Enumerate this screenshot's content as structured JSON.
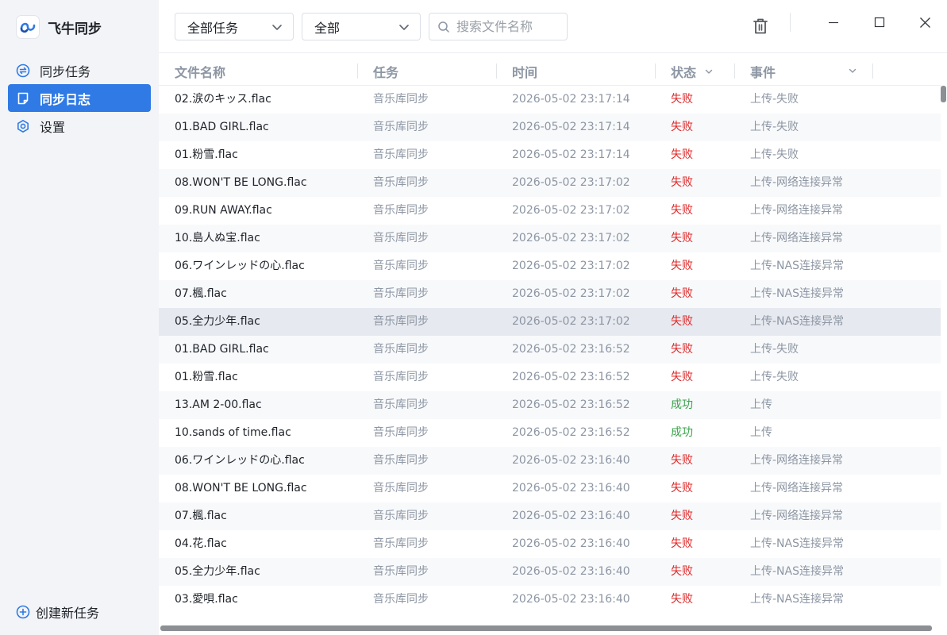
{
  "app": {
    "name": "飞牛同步"
  },
  "sidebar": {
    "items": [
      {
        "label": "同步任务",
        "icon": "sync-icon",
        "active": false
      },
      {
        "label": "同步日志",
        "icon": "log-icon",
        "active": true
      },
      {
        "label": "设置",
        "icon": "gear-icon",
        "active": false
      }
    ],
    "create_label": "创建新任务"
  },
  "toolbar": {
    "task_filter": "全部任务",
    "type_filter": "全部",
    "search_placeholder": "搜索文件名称"
  },
  "table": {
    "columns": [
      "文件名称",
      "任务",
      "时间",
      "状态",
      "事件"
    ],
    "selected_row": 8,
    "status_colors": {
      "失败": "#e02828",
      "成功": "#38a34a"
    },
    "rows": [
      {
        "name": "02.涙のキッス.flac",
        "task": "音乐库同步",
        "time": "2026-05-02 23:17:14",
        "status": "失败",
        "event": "上传-失败"
      },
      {
        "name": "01.BAD GIRL.flac",
        "task": "音乐库同步",
        "time": "2026-05-02 23:17:14",
        "status": "失败",
        "event": "上传-失败"
      },
      {
        "name": "01.粉雪.flac",
        "task": "音乐库同步",
        "time": "2026-05-02 23:17:14",
        "status": "失败",
        "event": "上传-失败"
      },
      {
        "name": "08.WON'T BE LONG.flac",
        "task": "音乐库同步",
        "time": "2026-05-02 23:17:02",
        "status": "失败",
        "event": "上传-网络连接异常"
      },
      {
        "name": "09.RUN AWAY.flac",
        "task": "音乐库同步",
        "time": "2026-05-02 23:17:02",
        "status": "失败",
        "event": "上传-网络连接异常"
      },
      {
        "name": "10.島人ぬ宝.flac",
        "task": "音乐库同步",
        "time": "2026-05-02 23:17:02",
        "status": "失败",
        "event": "上传-网络连接异常"
      },
      {
        "name": "06.ワインレッドの心.flac",
        "task": "音乐库同步",
        "time": "2026-05-02 23:17:02",
        "status": "失败",
        "event": "上传-NAS连接异常"
      },
      {
        "name": "07.楓.flac",
        "task": "音乐库同步",
        "time": "2026-05-02 23:17:02",
        "status": "失败",
        "event": "上传-NAS连接异常"
      },
      {
        "name": "05.全力少年.flac",
        "task": "音乐库同步",
        "time": "2026-05-02 23:17:02",
        "status": "失败",
        "event": "上传-NAS连接异常"
      },
      {
        "name": "01.BAD GIRL.flac",
        "task": "音乐库同步",
        "time": "2026-05-02 23:16:52",
        "status": "失败",
        "event": "上传-失败"
      },
      {
        "name": "01.粉雪.flac",
        "task": "音乐库同步",
        "time": "2026-05-02 23:16:52",
        "status": "失败",
        "event": "上传-失败"
      },
      {
        "name": "13.AM 2-00.flac",
        "task": "音乐库同步",
        "time": "2026-05-02 23:16:52",
        "status": "成功",
        "event": "上传"
      },
      {
        "name": "10.sands of time.flac",
        "task": "音乐库同步",
        "time": "2026-05-02 23:16:52",
        "status": "成功",
        "event": "上传"
      },
      {
        "name": "06.ワインレッドの心.flac",
        "task": "音乐库同步",
        "time": "2026-05-02 23:16:40",
        "status": "失败",
        "event": "上传-网络连接异常"
      },
      {
        "name": "08.WON'T BE LONG.flac",
        "task": "音乐库同步",
        "time": "2026-05-02 23:16:40",
        "status": "失败",
        "event": "上传-网络连接异常"
      },
      {
        "name": "07.楓.flac",
        "task": "音乐库同步",
        "time": "2026-05-02 23:16:40",
        "status": "失败",
        "event": "上传-网络连接异常"
      },
      {
        "name": "04.花.flac",
        "task": "音乐库同步",
        "time": "2026-05-02 23:16:40",
        "status": "失败",
        "event": "上传-NAS连接异常"
      },
      {
        "name": "05.全力少年.flac",
        "task": "音乐库同步",
        "time": "2026-05-02 23:16:40",
        "status": "失败",
        "event": "上传-NAS连接异常"
      },
      {
        "name": "03.愛唄.flac",
        "task": "音乐库同步",
        "time": "2026-05-02 23:16:40",
        "status": "失败",
        "event": "上传-NAS连接异常"
      }
    ]
  }
}
